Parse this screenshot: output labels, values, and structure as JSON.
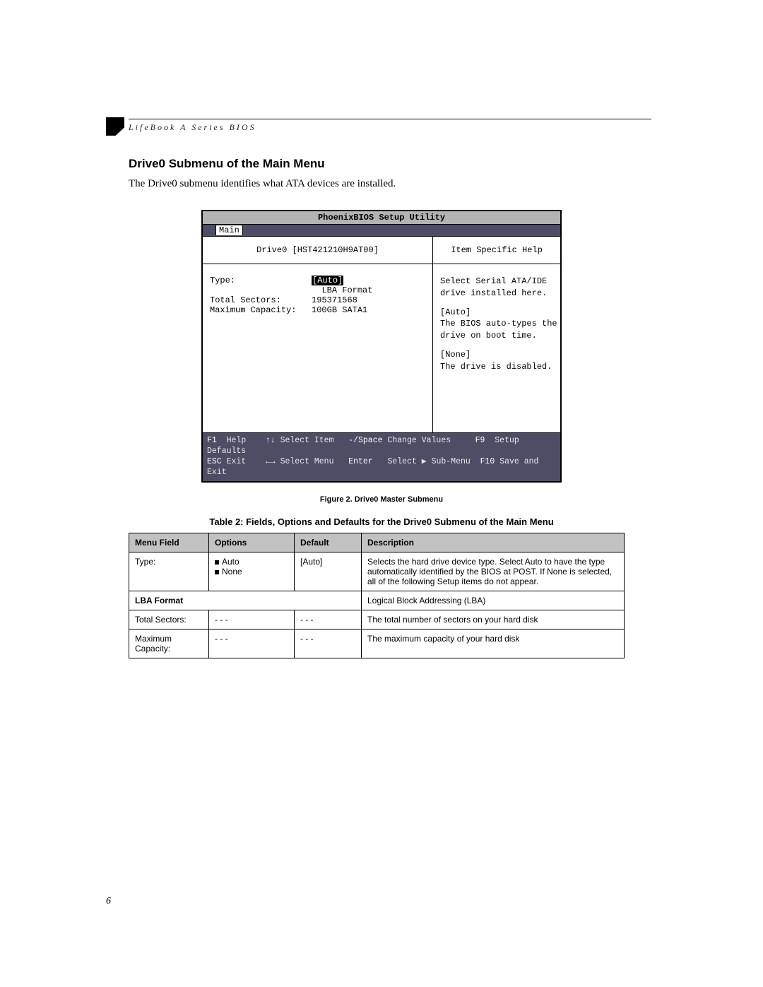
{
  "running_head": "LifeBook A Series BIOS",
  "section_heading": "Drive0 Submenu of the Main Menu",
  "intro_text": "The Drive0 submenu identifies what ATA devices are installed.",
  "bios": {
    "title": "PhoenixBIOS Setup Utility",
    "tab": "Main",
    "header_left": "Drive0 [HST421210H9AT00]",
    "header_right": "Item Specific Help",
    "fields": {
      "type_label": "Type:",
      "type_value": "[Auto]",
      "lba": "LBA Format",
      "sectors_label": "Total Sectors:",
      "sectors_value": "195371568",
      "cap_label": "Maximum Capacity:",
      "cap_value": "100GB SATA1"
    },
    "help": {
      "p1": "Select Serial ATA/IDE\ndrive installed here.",
      "p2": "[Auto]\nThe BIOS auto-types the\ndrive on boot time.",
      "p3": "[None]\nThe drive is disabled."
    },
    "footer": {
      "f1": "F1",
      "help": "Help",
      "arrows_v": "↑↓",
      "sel_item": "Select Item",
      "pm": "-/Space",
      "chg": "Change Values",
      "f9": "F9",
      "defaults": "Setup Defaults",
      "esc": "ESC",
      "exit": "Exit",
      "arrows_h": "←→",
      "sel_menu": "Select Menu",
      "enter": "Enter",
      "sub": "Select ▶ Sub-Menu",
      "f10": "F10",
      "save": "Save and Exit"
    }
  },
  "figure_caption": "Figure 2.  Drive0 Master Submenu",
  "table_title": "Table 2: Fields, Options and Defaults for the Drive0 Submenu of the Main Menu",
  "table": {
    "headers": {
      "c1": "Menu Field",
      "c2": "Options",
      "c3": "Default",
      "c4": "Description"
    },
    "rows": [
      {
        "field": "Type:",
        "opt1": "Auto",
        "opt2": "None",
        "def": "[Auto]",
        "desc": "Selects the hard drive device type. Select Auto to have the type automatically identified by the BIOS at POST. If None is selected, all of the following Setup items do not appear."
      },
      {
        "field_bold": "LBA Format",
        "desc": "Logical Block Addressing (LBA)"
      },
      {
        "field": "Total Sectors:",
        "opt_text": "- - -",
        "def": "- - -",
        "desc": "The total number of sectors on your hard disk"
      },
      {
        "field": "Maximum Capacity:",
        "opt_text": "- - -",
        "def": "- - -",
        "desc": "The maximum capacity of your hard disk"
      }
    ]
  },
  "page_number": "6"
}
